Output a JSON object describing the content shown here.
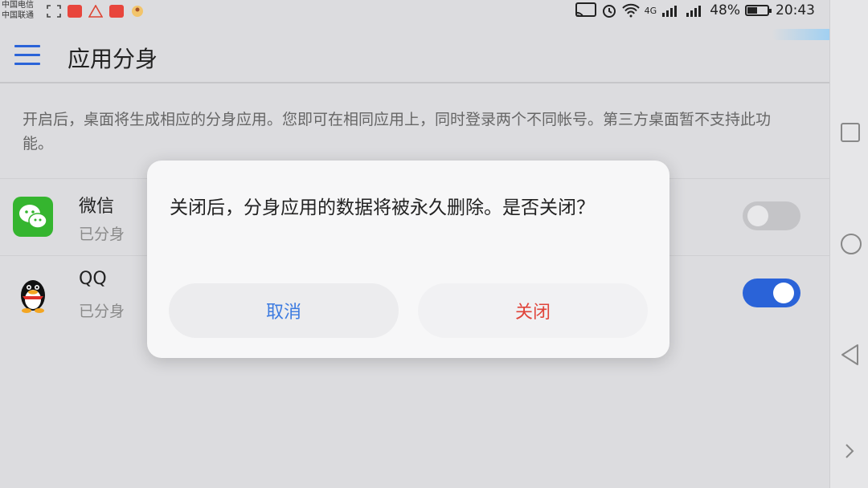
{
  "status_bar": {
    "carrier_1": "中国电信",
    "carrier_2": "中国联通",
    "signal_text": "4G",
    "battery": "48%",
    "battery_level": 0.48,
    "time": "20:43"
  },
  "header": {
    "title": "应用分身"
  },
  "description": "开启后，桌面将生成相应的分身应用。您即可在相同应用上，同时登录两个不同帐号。第三方桌面暂不支持此功能。",
  "apps": [
    {
      "name": "微信",
      "status": "已分身",
      "enabled": false,
      "icon": "wechat-icon"
    },
    {
      "name": "QQ",
      "status": "已分身",
      "enabled": true,
      "icon": "qq-penguin-icon"
    }
  ],
  "dialog": {
    "message": "关闭后，分身应用的数据将被永久删除。是否关闭？",
    "cancel_label": "取消",
    "confirm_label": "关闭"
  },
  "colors": {
    "accent": "#2a63d8",
    "cancel_text": "#3d7be0",
    "confirm_text": "#e0443a",
    "wechat_green": "#35b52f"
  }
}
